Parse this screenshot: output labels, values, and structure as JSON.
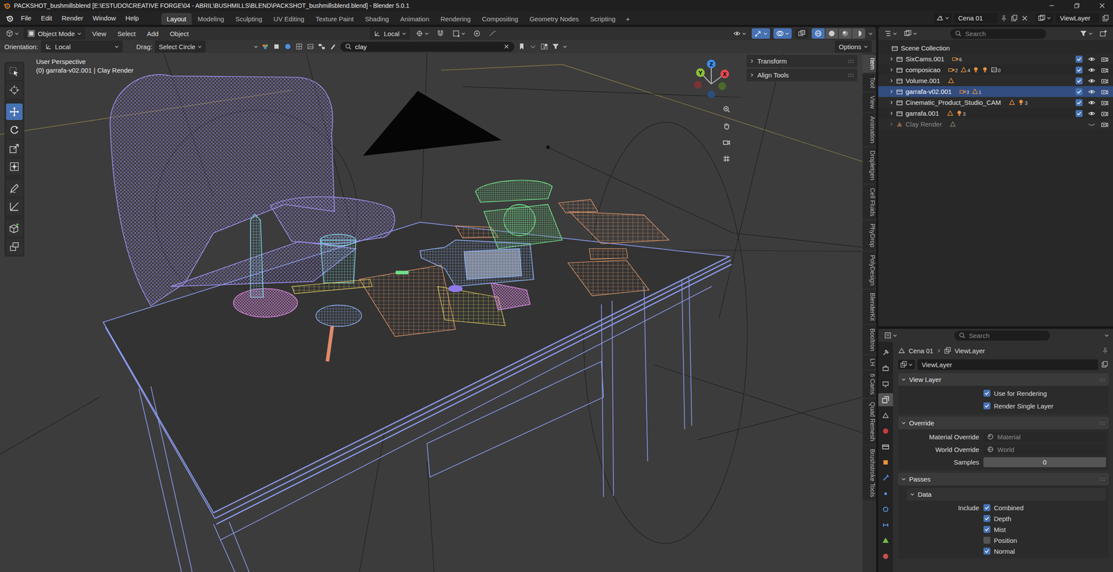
{
  "window": {
    "title": "PACKSHOT_bushmillsblend [E:\\ESTUDO\\CREATIVE FORGE\\04 - ABRIL\\BUSHMILLS\\BLEND\\PACKSHOT_bushmillsblend.blend] - Blender 5.0.1"
  },
  "menu": [
    "File",
    "Edit",
    "Render",
    "Window",
    "Help"
  ],
  "workspaces": [
    {
      "label": "Layout",
      "selected": true
    },
    {
      "label": "Modeling",
      "selected": false
    },
    {
      "label": "Sculpting",
      "selected": false
    },
    {
      "label": "UV Editing",
      "selected": false
    },
    {
      "label": "Texture Paint",
      "selected": false
    },
    {
      "label": "Shading",
      "selected": false
    },
    {
      "label": "Animation",
      "selected": false
    },
    {
      "label": "Rendering",
      "selected": false
    },
    {
      "label": "Compositing",
      "selected": false
    },
    {
      "label": "Geometry Nodes",
      "selected": false
    },
    {
      "label": "Scripting",
      "selected": false
    }
  ],
  "add_workspace": "+",
  "scene": {
    "name": "Cena 01",
    "view_layer": "ViewLayer"
  },
  "viewport": {
    "mode": "Object Mode",
    "menus": [
      "View",
      "Select",
      "Add",
      "Object"
    ],
    "transform_orientation": "Local",
    "toggles": [
      {
        "kind": "gizmos",
        "on": true
      },
      {
        "kind": "overlays",
        "on": true
      },
      {
        "kind": "xray",
        "on": false
      }
    ],
    "shading": [
      {
        "mode": "wireframe",
        "selected": true
      },
      {
        "mode": "solid",
        "selected": false
      },
      {
        "mode": "material",
        "selected": false
      },
      {
        "mode": "rendered",
        "selected": false
      }
    ],
    "orientation_label": "Orientation:",
    "orientation_value": "Local",
    "drag_label": "Drag:",
    "drag_value": "Select Circle",
    "search": "clay",
    "options": "Options",
    "perspective": "User Perspective",
    "active": "(0) garrafa-v02.001 | Clay Render",
    "panels": [
      "Transform",
      "Align Tools"
    ],
    "gizmo": {
      "x": "X",
      "y": "Y",
      "z": "Z"
    },
    "tools": [
      {
        "tool": "select",
        "selected": false
      },
      {
        "tool": "cursor",
        "selected": false
      },
      {
        "tool": "move",
        "selected": true
      },
      {
        "tool": "rotate",
        "selected": false
      },
      {
        "tool": "scale",
        "selected": false
      },
      {
        "tool": "transform",
        "selected": false
      },
      {
        "tool": "annotate",
        "selected": false
      },
      {
        "tool": "measure",
        "selected": false
      },
      {
        "tool": "add-cube",
        "selected": false
      },
      {
        "tool": "extrude",
        "selected": false
      }
    ],
    "tabs": [
      {
        "label": "Item",
        "selected": true
      },
      {
        "label": "Tool",
        "selected": false
      },
      {
        "label": "View",
        "selected": false
      },
      {
        "label": "Animation",
        "selected": false
      },
      {
        "label": "Dropletgen",
        "selected": false
      },
      {
        "label": "Cell Fluids",
        "selected": false
      },
      {
        "label": "PhyDrop",
        "selected": false
      },
      {
        "label": "PolyDesign",
        "selected": false
      },
      {
        "label": "BlenderKit",
        "selected": false
      },
      {
        "label": "Booltron",
        "selected": false
      },
      {
        "label": "LH",
        "selected": false
      },
      {
        "label": "6 Cams",
        "selected": false
      },
      {
        "label": "Quad Remesh",
        "selected": false
      },
      {
        "label": "Brushstroke Tools",
        "selected": false
      }
    ]
  },
  "outliner": {
    "search_placeholder": "Search",
    "rows": [
      {
        "name": "Scene Collection",
        "kind": "scene",
        "selected": false,
        "disabled": false,
        "icons": []
      },
      {
        "name": "SixCams.001",
        "kind": "collection",
        "expanded": false,
        "selected": false,
        "disabled": false,
        "checked": true,
        "visible": true,
        "renderable": true,
        "icons": [
          {
            "kind": "camera",
            "count": "6"
          }
        ]
      },
      {
        "name": "composicao",
        "kind": "collection",
        "expanded": false,
        "selected": false,
        "disabled": false,
        "checked": true,
        "visible": true,
        "renderable": true,
        "icons": [
          {
            "kind": "camera",
            "count": "2"
          },
          {
            "kind": "mesh",
            "count": "4"
          },
          {
            "kind": "light"
          },
          {
            "kind": "light"
          },
          {
            "kind": "image",
            "count": "0"
          }
        ]
      },
      {
        "name": "Volume.001",
        "kind": "collection",
        "expanded": false,
        "selected": false,
        "disabled": false,
        "checked": true,
        "visible": true,
        "renderable": true,
        "icons": [
          {
            "kind": "mesh"
          }
        ]
      },
      {
        "name": "garrafa-v02.001",
        "kind": "collection",
        "expanded": false,
        "selected": true,
        "disabled": false,
        "checked": true,
        "visible": true,
        "renderable": true,
        "icons": [
          {
            "kind": "camera",
            "count": "3"
          },
          {
            "kind": "mesh",
            "count": "1"
          }
        ]
      },
      {
        "name": "Cinematic_Product_Studio_CAM",
        "kind": "collection",
        "expanded": false,
        "selected": false,
        "disabled": false,
        "checked": true,
        "visible": true,
        "renderable": true,
        "icons": [
          {
            "kind": "mesh"
          },
          {
            "kind": "light",
            "count": "3"
          }
        ]
      },
      {
        "name": "garrafa.001",
        "kind": "collection",
        "expanded": false,
        "selected": false,
        "disabled": false,
        "checked": true,
        "visible": true,
        "renderable": true,
        "icons": [
          {
            "kind": "mesh"
          },
          {
            "kind": "light",
            "count": "3"
          }
        ]
      },
      {
        "name": "Clay Render",
        "kind": "object",
        "expanded": false,
        "selected": false,
        "disabled": true,
        "visible": false,
        "renderable": true,
        "icons": [
          {
            "kind": "mesh"
          }
        ]
      }
    ]
  },
  "properties": {
    "search_placeholder": "Search",
    "tabs": [
      {
        "tab": "tool",
        "selected": false
      },
      {
        "tab": "render",
        "selected": false
      },
      {
        "tab": "output",
        "selected": false
      },
      {
        "tab": "view_layer",
        "selected": true
      },
      {
        "tab": "scene",
        "selected": false
      },
      {
        "tab": "world",
        "selected": false
      },
      {
        "tab": "collection",
        "selected": false
      },
      {
        "tab": "object",
        "selected": false
      },
      {
        "tab": "modifiers",
        "selected": false
      },
      {
        "tab": "particles",
        "selected": false
      },
      {
        "tab": "physics",
        "selected": false
      },
      {
        "tab": "constraints",
        "selected": false
      },
      {
        "tab": "data",
        "selected": false
      },
      {
        "tab": "material",
        "selected": false
      }
    ],
    "breadcrumb": [
      "Cena 01",
      "ViewLayer"
    ],
    "name_field": "ViewLayer",
    "view_layer": {
      "title": "View Layer",
      "expanded": true,
      "options": [
        {
          "label": "Use for Rendering",
          "checked": true
        },
        {
          "label": "Render Single Layer",
          "checked": true
        }
      ]
    },
    "override": {
      "title": "Override",
      "expanded": true,
      "material_label": "Material Override",
      "material_placeholder": "Material",
      "world_label": "World Override",
      "world_placeholder": "World",
      "samples_label": "Samples",
      "samples_value": "0"
    },
    "passes": {
      "title": "Passes",
      "expanded": true,
      "data_title": "Data",
      "data_expanded": true,
      "include_label": "Include",
      "items": [
        {
          "label": "Combined",
          "checked": true
        },
        {
          "label": "Depth",
          "checked": true
        },
        {
          "label": "Mist",
          "checked": true
        },
        {
          "label": "Position",
          "checked": false
        },
        {
          "label": "Normal",
          "checked": true
        }
      ]
    }
  }
}
